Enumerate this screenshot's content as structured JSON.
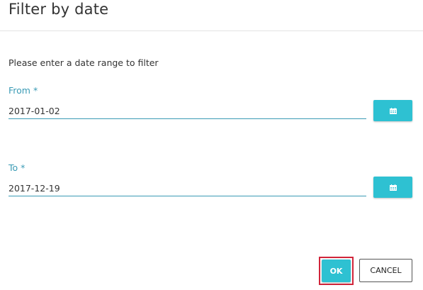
{
  "dialog": {
    "title": "Filter by date",
    "description": "Please enter a date range to filter"
  },
  "from": {
    "label": "From *",
    "value": "2017-01-02",
    "calendar_icon": "calendar-icon"
  },
  "to": {
    "label": "To *",
    "value": "2017-12-19",
    "calendar_icon": "calendar-icon"
  },
  "actions": {
    "ok_label": "OK",
    "cancel_label": "CANCEL"
  },
  "colors": {
    "accent": "#2ec1d2",
    "label": "#3a9bb5",
    "highlight": "#d0253a"
  }
}
